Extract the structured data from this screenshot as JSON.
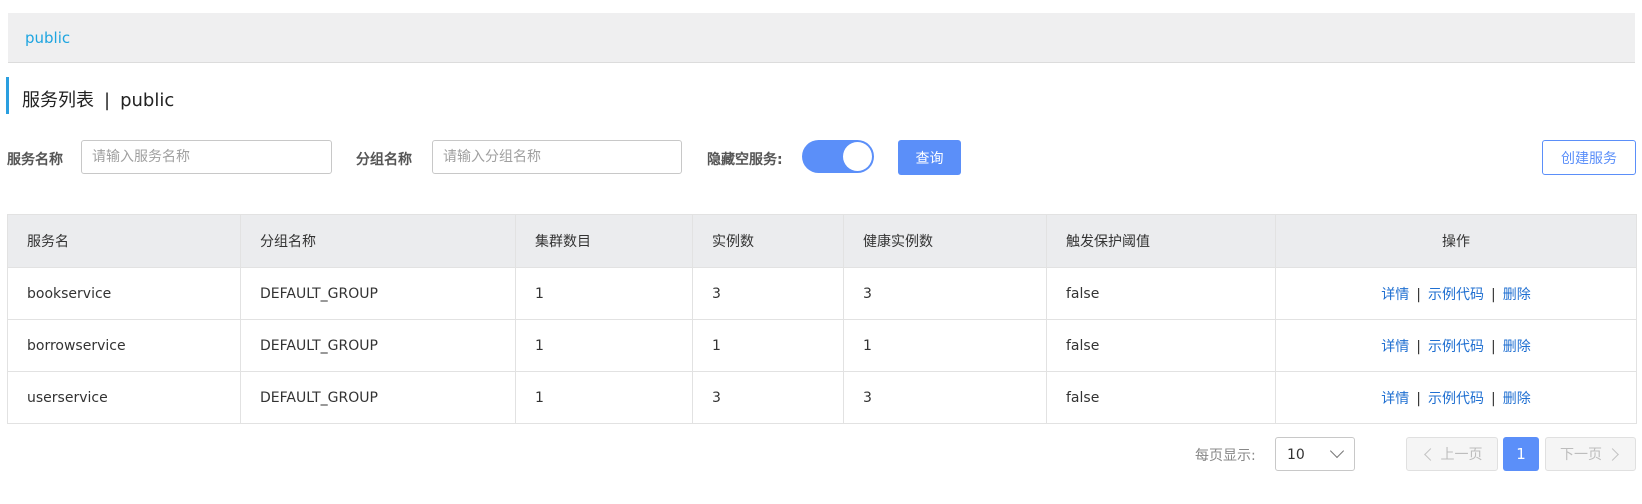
{
  "namespace_bar": {
    "active": "public"
  },
  "header": {
    "title": "服务列表",
    "separator": "|",
    "namespace": "public"
  },
  "filters": {
    "service_name": {
      "label": "服务名称",
      "placeholder": "请输入服务名称",
      "value": ""
    },
    "group_name": {
      "label": "分组名称",
      "placeholder": "请输入分组名称",
      "value": ""
    },
    "hide_empty": {
      "label": "隐藏空服务:",
      "on": true
    },
    "query_button": "查询",
    "create_button": "创建服务"
  },
  "table": {
    "columns": [
      "服务名",
      "分组名称",
      "集群数目",
      "实例数",
      "健康实例数",
      "触发保护阈值",
      "操作"
    ],
    "rows": [
      {
        "name": "bookservice",
        "group": "DEFAULT_GROUP",
        "clusters": "1",
        "instances": "3",
        "healthy": "3",
        "threshold": "false"
      },
      {
        "name": "borrowservice",
        "group": "DEFAULT_GROUP",
        "clusters": "1",
        "instances": "1",
        "healthy": "1",
        "threshold": "false"
      },
      {
        "name": "userservice",
        "group": "DEFAULT_GROUP",
        "clusters": "1",
        "instances": "3",
        "healthy": "3",
        "threshold": "false"
      }
    ],
    "actions": {
      "detail": "详情",
      "sample_code": "示例代码",
      "delete": "删除",
      "separator": "|"
    }
  },
  "pagination": {
    "page_size_label": "每页显示:",
    "page_size": "10",
    "prev": "上一页",
    "current_page": "1",
    "next": "下一页"
  },
  "colors": {
    "primary": "#5b8ff9",
    "link": "#1f6fd1",
    "namespace_link": "#1ea5e0",
    "title_accent": "#2a9fe0"
  }
}
